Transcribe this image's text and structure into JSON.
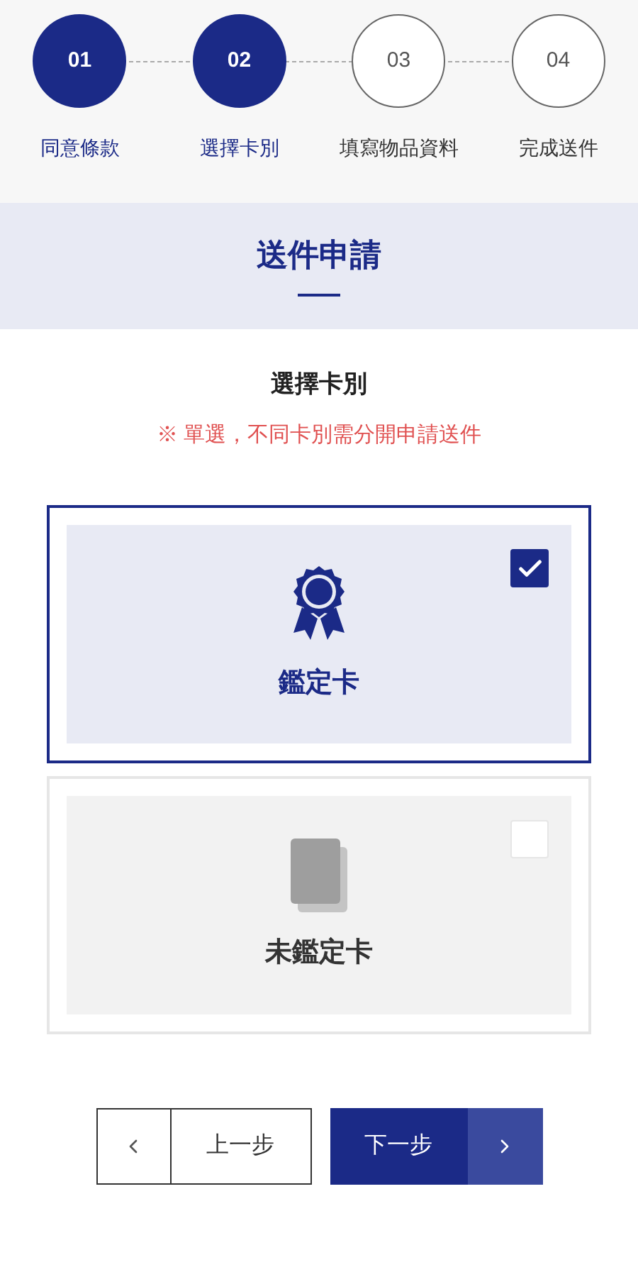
{
  "steps": [
    {
      "number": "01",
      "label": "同意條款",
      "done": true
    },
    {
      "number": "02",
      "label": "選擇卡別",
      "done": true
    },
    {
      "number": "03",
      "label": "填寫物品資料",
      "done": false
    },
    {
      "number": "04",
      "label": "完成送件",
      "done": false
    }
  ],
  "banner": {
    "title": "送件申請"
  },
  "section": {
    "title": "選擇卡別",
    "note": "※ 單選，不同卡別需分開申請送件"
  },
  "options": [
    {
      "kind": "certified",
      "label": "鑑定卡",
      "selected": true
    },
    {
      "kind": "uncertified",
      "label": "未鑑定卡",
      "selected": false
    }
  ],
  "buttons": {
    "prev": "上一步",
    "next": "下一步"
  }
}
